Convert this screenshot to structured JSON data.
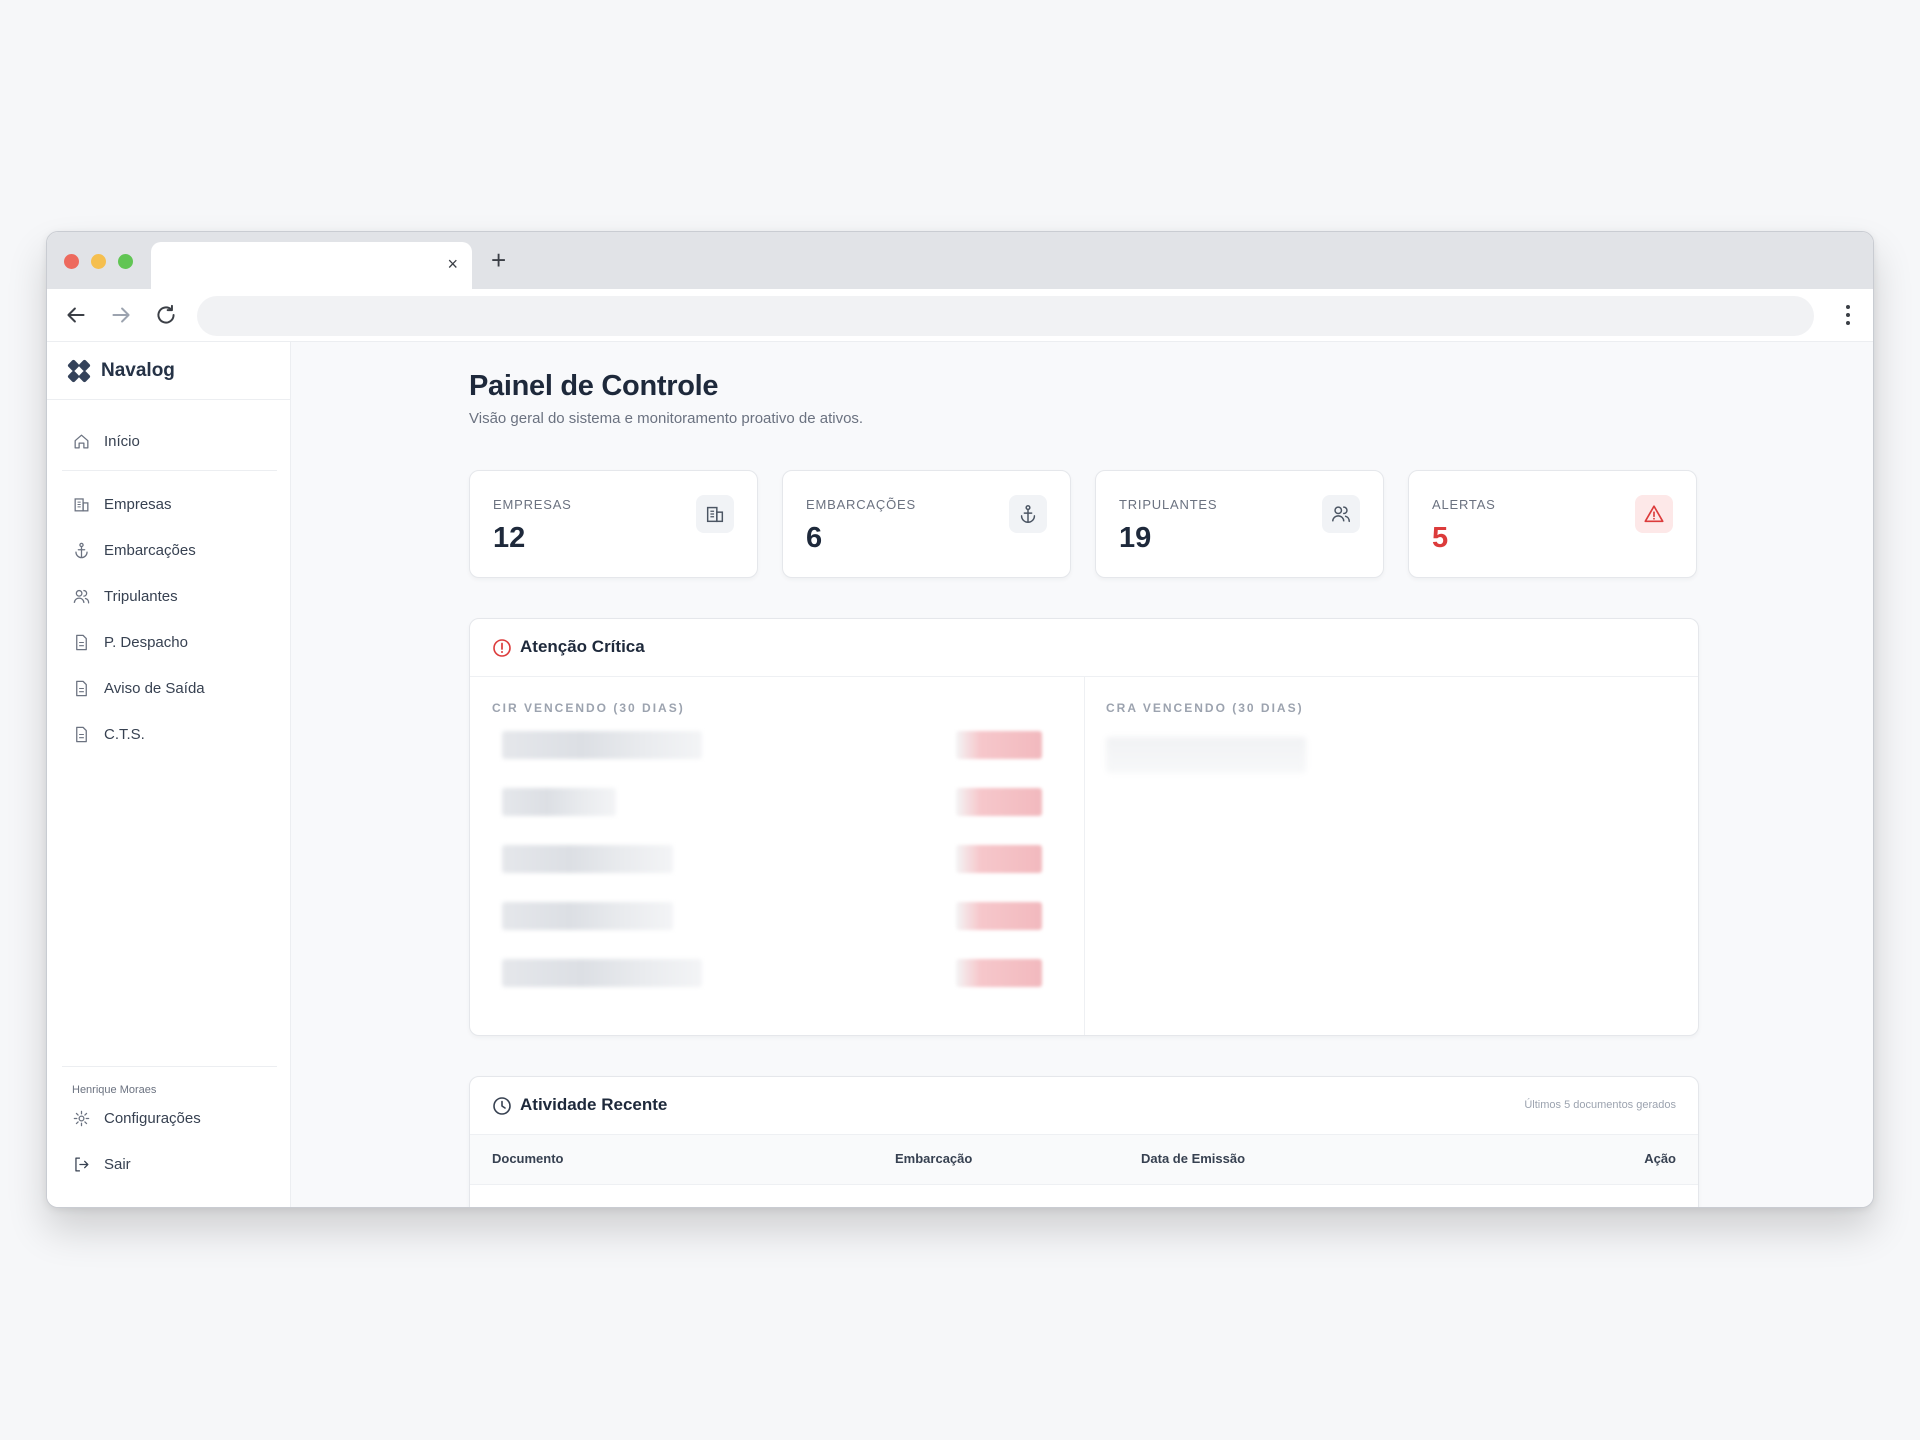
{
  "browser": {
    "tab_title": "",
    "tab_close": "×",
    "new_tab": "+",
    "address": ""
  },
  "sidebar": {
    "brand": "Navalog",
    "items": [
      {
        "label": "Início",
        "icon": "home-icon"
      },
      {
        "label": "Empresas",
        "icon": "building-icon"
      },
      {
        "label": "Embarcações",
        "icon": "anchor-icon"
      },
      {
        "label": "Tripulantes",
        "icon": "users-icon"
      },
      {
        "label": "P. Despacho",
        "icon": "document-icon"
      },
      {
        "label": "Aviso de Saída",
        "icon": "document-icon"
      },
      {
        "label": "C.T.S.",
        "icon": "document-icon"
      }
    ],
    "user": "Henrique Moraes",
    "settings_label": "Configurações",
    "logout_label": "Sair"
  },
  "main": {
    "title": "Painel de Controle",
    "subtitle": "Visão geral do sistema e monitoramento proativo de ativos.",
    "stats": [
      {
        "label": "EMPRESAS",
        "value": "12",
        "icon": "building-icon"
      },
      {
        "label": "EMBARCAÇÕES",
        "value": "6",
        "icon": "anchor-icon"
      },
      {
        "label": "TRIPULANTES",
        "value": "19",
        "icon": "users-icon"
      },
      {
        "label": "ALERTAS",
        "value": "5",
        "icon": "warning-triangle-icon"
      }
    ],
    "critical": {
      "title": "Atenção Crítica",
      "cir_title": "CIR VENCENDO (30 DIAS)",
      "cra_title": "CRA VENCENDO (30 DIAS)"
    },
    "activity": {
      "title": "Atividade Recente",
      "note": "Últimos 5 documentos gerados",
      "columns": [
        "Documento",
        "Embarcação",
        "Data de Emissão",
        "Ação"
      ]
    }
  },
  "colors": {
    "accent": "#253246",
    "alert": "#dc3b3b",
    "traffic_red": "#ed6a5e",
    "traffic_yellow": "#f5bf4f",
    "traffic_green": "#61c554"
  }
}
